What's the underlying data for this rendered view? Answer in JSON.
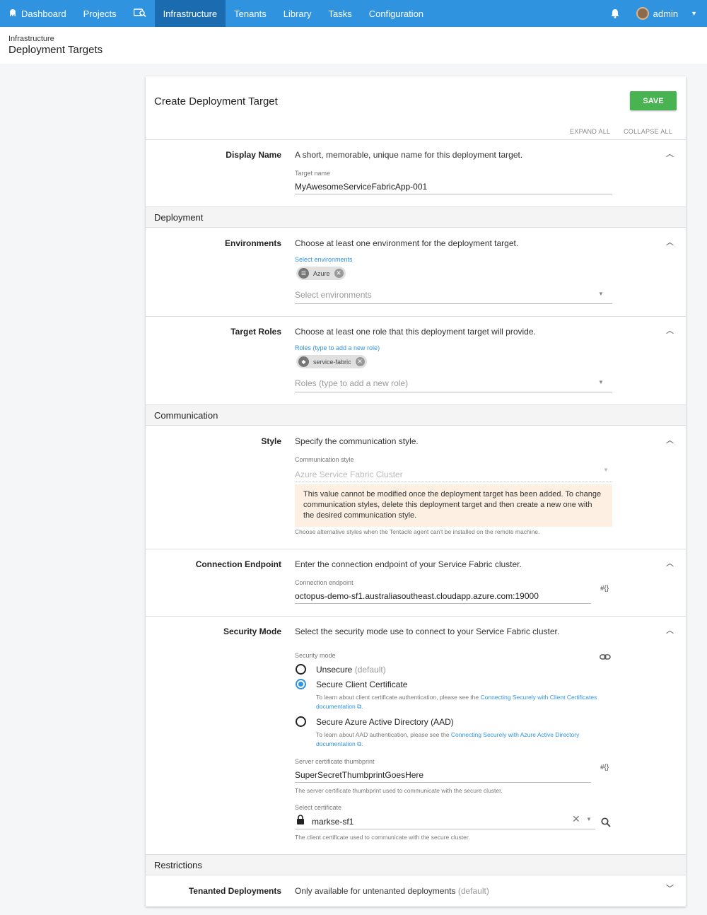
{
  "nav": {
    "items": [
      {
        "label": "Dashboard",
        "icon": "octopus-icon"
      },
      {
        "label": "Projects"
      },
      {
        "label": "",
        "icon": "search-machines-icon"
      },
      {
        "label": "Infrastructure"
      },
      {
        "label": "Tenants"
      },
      {
        "label": "Library"
      },
      {
        "label": "Tasks"
      },
      {
        "label": "Configuration"
      }
    ],
    "active": "Infrastructure",
    "user": "admin",
    "accent": "#2f93e0"
  },
  "header": {
    "breadcrumb": "Infrastructure",
    "title": "Deployment Targets"
  },
  "card": {
    "title": "Create Deployment Target",
    "save": "SAVE",
    "expand_all": "EXPAND ALL",
    "collapse_all": "COLLAPSE ALL"
  },
  "display_name": {
    "label": "Display Name",
    "desc": "A short, memorable, unique name for this deployment target.",
    "field_label": "Target name",
    "value": "MyAwesomeServiceFabricApp-001"
  },
  "groups": {
    "deployment": "Deployment",
    "communication": "Communication",
    "restrictions": "Restrictions"
  },
  "environments": {
    "label": "Environments",
    "desc": "Choose at least one environment for the deployment target.",
    "field_label": "Select environments",
    "chip": "Azure",
    "placeholder": "Select environments"
  },
  "roles": {
    "label": "Target Roles",
    "desc": "Choose at least one role that this deployment target will provide.",
    "field_label": "Roles (type to add a new role)",
    "chip": "service-fabric",
    "placeholder": "Roles (type to add a new role)"
  },
  "style": {
    "label": "Style",
    "desc": "Specify the communication style.",
    "field_label": "Communication style",
    "value": "Azure Service Fabric Cluster",
    "warning": "This value cannot be modified once the deployment target has been added. To change communication styles, delete this deployment target and then create a new one with the desired communication style.",
    "helper": "Choose alternative styles when the Tentacle agent can't be installed on the remote machine."
  },
  "endpoint": {
    "label": "Connection Endpoint",
    "desc": "Enter the connection endpoint of your Service Fabric cluster.",
    "field_label": "Connection endpoint",
    "value": "octopus-demo-sf1.australiasoutheast.cloudapp.azure.com:19000",
    "var": "#{}"
  },
  "security": {
    "label": "Security Mode",
    "desc": "Select the security mode use to connect to your Service Fabric cluster.",
    "field_label": "Security mode",
    "opt1": "Unsecure",
    "opt1_suffix": "(default)",
    "opt2": "Secure Client Certificate",
    "opt2_help": "To learn about client certificate authentication, please see the ",
    "opt2_link": "Connecting Securely with Client Certificates documentation",
    "opt3": "Secure Azure Active Directory (AAD)",
    "opt3_help": "To learn about AAD authentication, please see the ",
    "opt3_link": "Connecting Securely with Azure Active Directory documentation",
    "selected": "Secure Client Certificate",
    "thumb_label": "Server certificate thumbprint",
    "thumb_value": "SuperSecretThumbprintGoesHere",
    "thumb_var": "#{}",
    "thumb_help": "The server certificate thumbprint used to communicate with the secure cluster.",
    "cert_label": "Select certificate",
    "cert_value": "markse-sf1",
    "cert_help": "The client certificate used to communicate with the secure cluster."
  },
  "tenanted": {
    "label": "Tenanted Deployments",
    "desc": "Only available for untenanted deployments",
    "desc_suffix": "(default)"
  }
}
